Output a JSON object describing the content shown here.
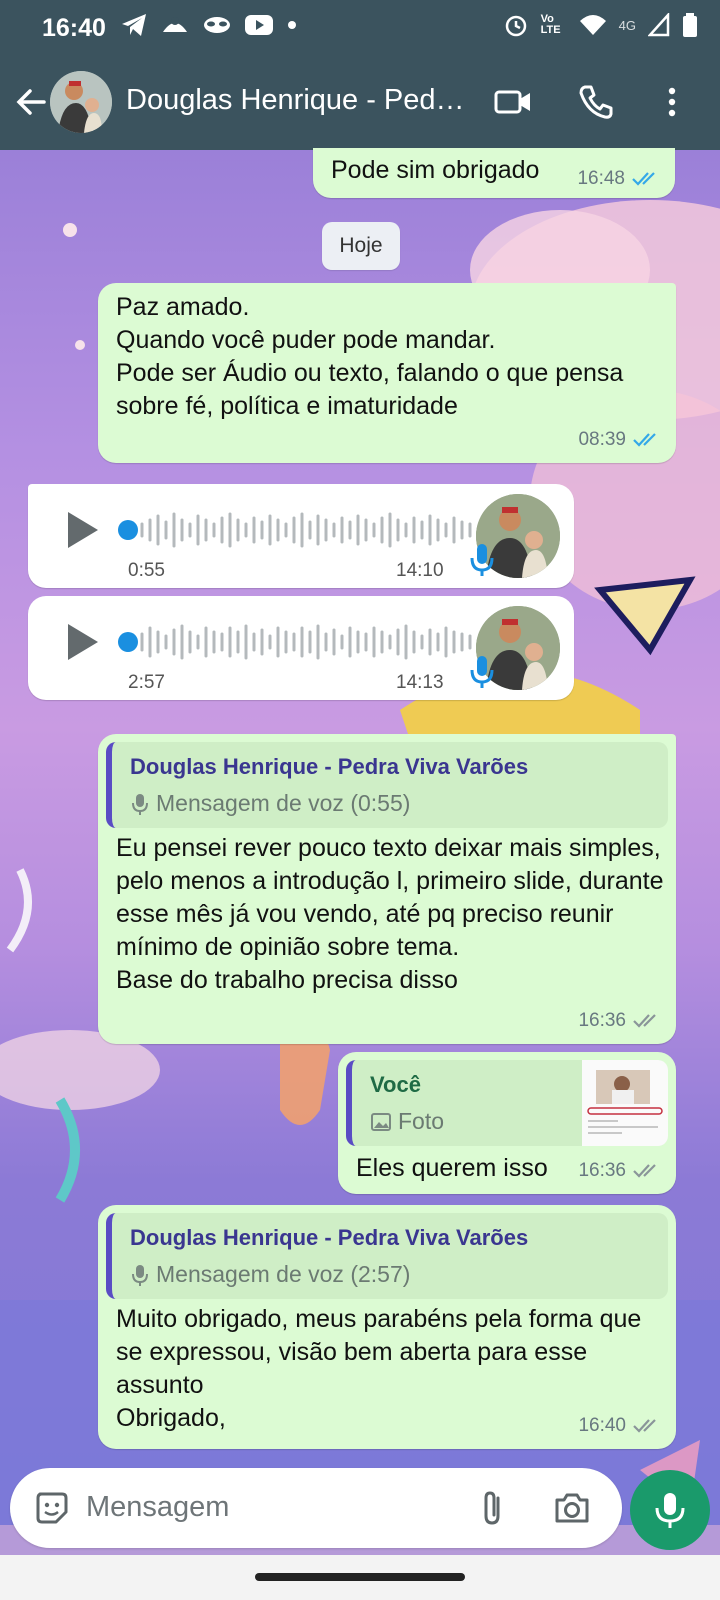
{
  "status_bar": {
    "time": "16:40",
    "network": "4G",
    "volte": "Vo LTE"
  },
  "header": {
    "title": "Douglas Henrique - Pedra Viva Varões"
  },
  "day_chip": "Hoje",
  "messages": [
    {
      "id": "m1",
      "direction": "out",
      "text": "Pode sim obrigado",
      "time": "16:48",
      "status": "read"
    },
    {
      "id": "m2",
      "direction": "out",
      "text": "Paz amado.\nQuando você puder pode mandar.\nPode ser Áudio ou texto, falando o que pensa sobre fé, política e imaturidade",
      "time": "08:39",
      "status": "read"
    },
    {
      "id": "m3",
      "direction": "in",
      "type": "voice",
      "duration": "0:55",
      "time": "14:10"
    },
    {
      "id": "m4",
      "direction": "in",
      "type": "voice",
      "duration": "2:57",
      "time": "14:13"
    },
    {
      "id": "m5",
      "direction": "out",
      "quote": {
        "author": "Douglas Henrique - Pedra Viva Varões",
        "preview": "Mensagem de voz (0:55)"
      },
      "text": "Eu pensei rever pouco texto deixar mais simples, pelo menos a introdução l, primeiro slide, durante esse mês já vou vendo, até pq preciso reunir mínimo de opinião sobre tema.\nBase do trabalho precisa disso",
      "time": "16:36",
      "status": "delivered"
    },
    {
      "id": "m6",
      "direction": "out",
      "quote": {
        "author": "Você",
        "preview": "Foto"
      },
      "text": "Eles querem isso",
      "time": "16:36",
      "status": "delivered"
    },
    {
      "id": "m7",
      "direction": "out",
      "quote": {
        "author": "Douglas Henrique - Pedra Viva Varões",
        "preview": "Mensagem de voz (2:57)"
      },
      "text": "Muito obrigado, meus parabéns pela forma que se expressou, visão bem aberta para esse assunto\nObrigado,",
      "time": "16:40",
      "status": "delivered"
    }
  ],
  "composer": {
    "placeholder": "Mensagem"
  },
  "colors": {
    "header": "#3b535e",
    "outgoing_bubble": "#dcfbd3",
    "incoming_bubble": "#ffffff",
    "read_tick": "#34a8e8",
    "delivered_tick": "#8a9599",
    "mic_button": "#1a9a6b",
    "voice_accent": "#1a8fe0"
  },
  "icons": [
    "back-arrow-icon",
    "video-call-icon",
    "voice-call-icon",
    "more-options-icon",
    "play-icon",
    "microphone-icon",
    "sticker-icon",
    "attach-icon",
    "camera-icon",
    "photo-icon",
    "double-tick-icon"
  ]
}
